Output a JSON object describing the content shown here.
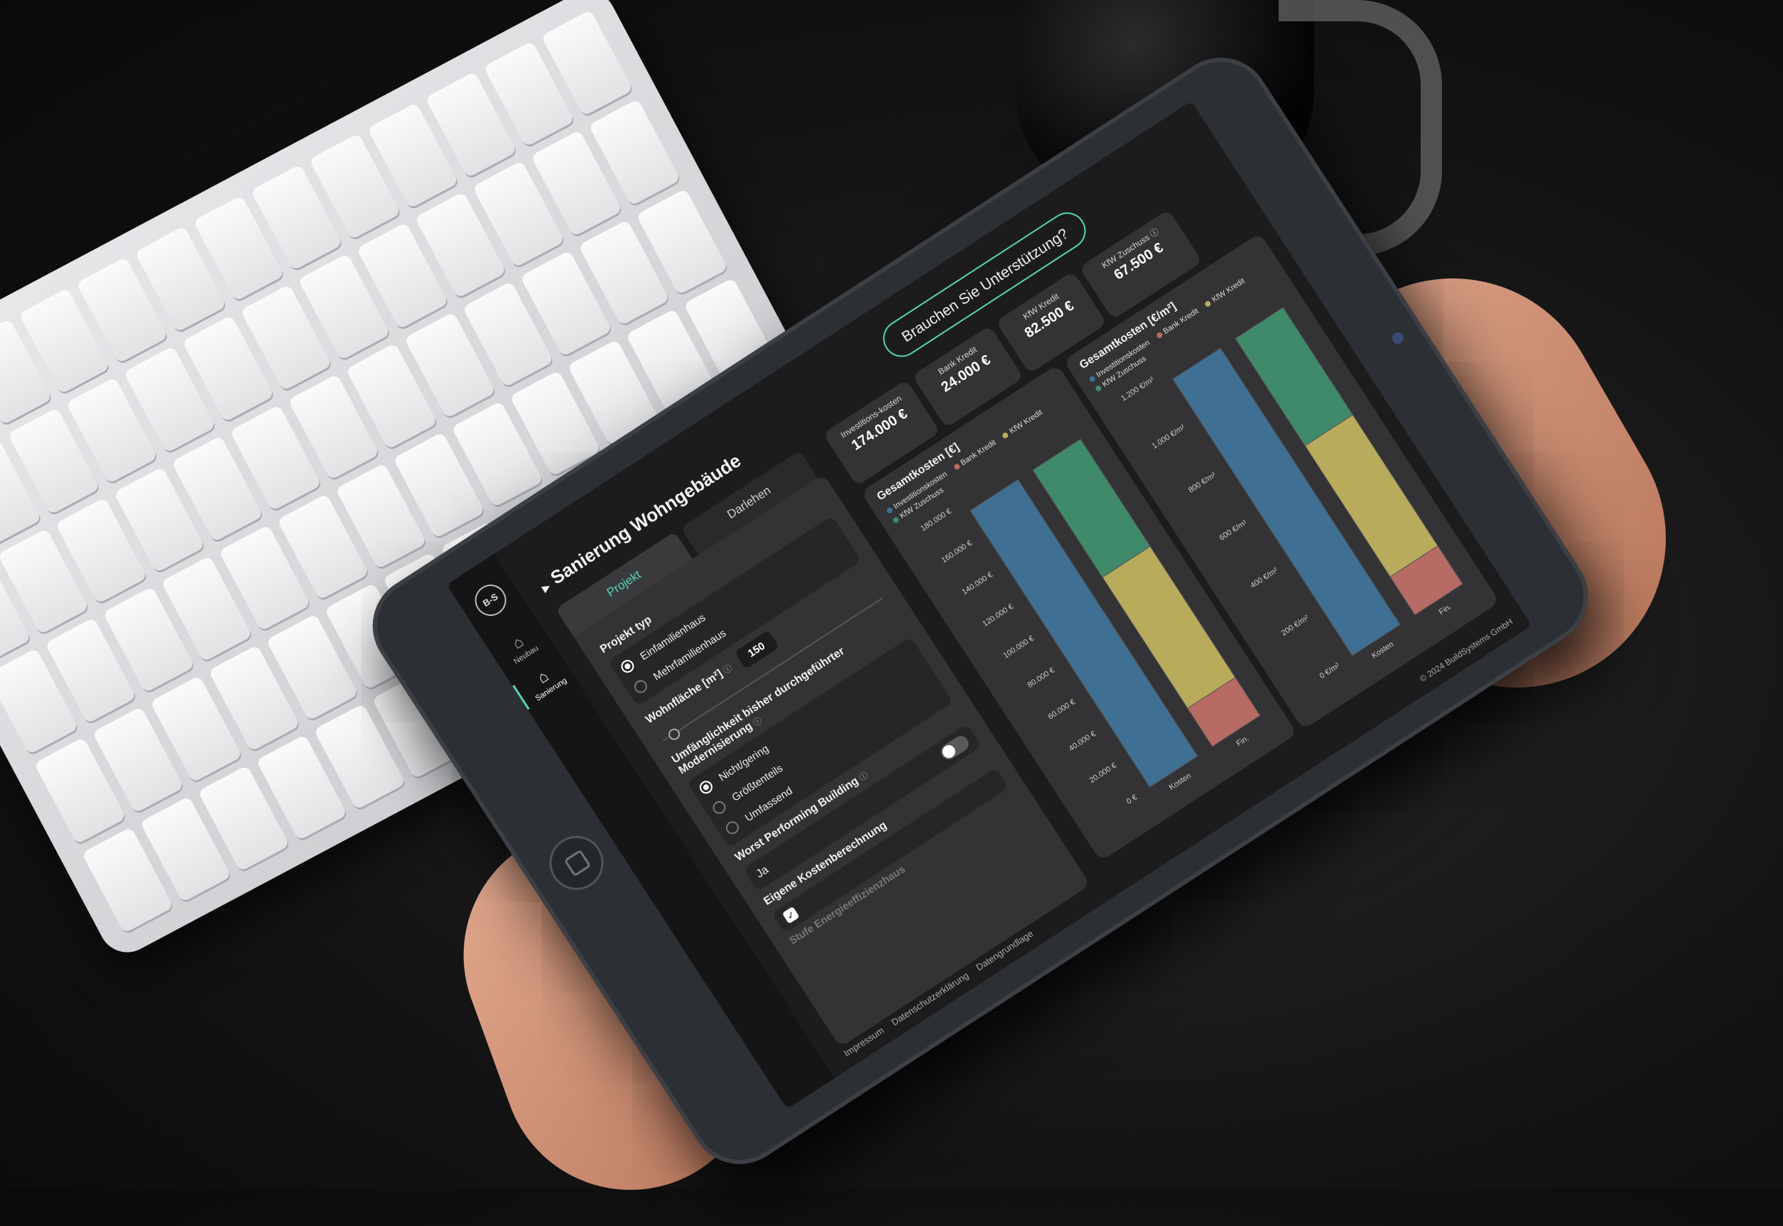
{
  "app": {
    "logo": "B-S",
    "title": "Sanierung Wohngebäude",
    "support_button": "Brauchen Sie Unterstützung?"
  },
  "sidebar": {
    "items": [
      {
        "label": "Neubau",
        "icon": "house-plus-icon"
      },
      {
        "label": "Sanierung",
        "icon": "house-renovate-icon"
      }
    ]
  },
  "tabs": [
    {
      "label": "Projekt",
      "active": true
    },
    {
      "label": "Darlehen",
      "active": false
    }
  ],
  "form": {
    "project_type_label": "Projekt typ",
    "project_type_options": [
      "Einfamilienhaus",
      "Mehrfamilienhaus"
    ],
    "area_label": "Wohnfläche [m²]",
    "area_value": "150",
    "modernization_label": "Umfänglichkeit bisher durchgeführter Modernisierung",
    "modernization_options": [
      "Nicht/gering",
      "Größtenteils",
      "Umfassend"
    ],
    "worst_performing_label": "Worst Performing Building",
    "worst_performing_value": "Ja",
    "own_cost_label": "Eigene Kostenberechnung",
    "energy_level_label": "Stufe Energieeffizienzhaus"
  },
  "stats": [
    {
      "label": "Investitions-kosten",
      "value": "174.000 €"
    },
    {
      "label": "Bank Kredit",
      "value": "24.000 €"
    },
    {
      "label": "KfW Kredit",
      "value": "82.500 €"
    },
    {
      "label": "KfW Zuschuss",
      "value": "67.500 €"
    }
  ],
  "colors": {
    "accent": "#55d7b6",
    "invest": "#3f6f93",
    "bank": "#b86a64",
    "kfw_kredit": "#b8ab5c",
    "kfw_zuschuss": "#3f8a6a"
  },
  "chart_data": [
    {
      "type": "bar",
      "stacked": true,
      "title": "Gesamtkosten [€]",
      "categories": [
        "Kosten",
        "Fin."
      ],
      "series": [
        {
          "name": "Investitionskosten",
          "values": [
            174000,
            0
          ]
        },
        {
          "name": "Bank Kredit",
          "values": [
            0,
            24000
          ]
        },
        {
          "name": "KfW Kredit",
          "values": [
            0,
            82500
          ]
        },
        {
          "name": "KfW Zuschuss",
          "values": [
            0,
            67500
          ]
        }
      ],
      "yticks": [
        "0 €",
        "20.000 €",
        "40.000 €",
        "60.000 €",
        "80.000 €",
        "100.000 €",
        "120.000 €",
        "140.000 €",
        "160.000 €",
        "180.000 €"
      ],
      "ylim": [
        0,
        180000
      ],
      "legend_position": "top-left"
    },
    {
      "type": "bar",
      "stacked": true,
      "title": "Gesamtkosten [€/m²]",
      "categories": [
        "Kosten",
        "Fin."
      ],
      "series": [
        {
          "name": "Investitionskosten",
          "values": [
            1160,
            0
          ]
        },
        {
          "name": "Bank Kredit",
          "values": [
            0,
            160
          ]
        },
        {
          "name": "KfW Kredit",
          "values": [
            0,
            550
          ]
        },
        {
          "name": "KfW Zuschuss",
          "values": [
            0,
            450
          ]
        }
      ],
      "yticks": [
        "0 €/m²",
        "200 €/m²",
        "400 €/m²",
        "600 €/m²",
        "800 €/m²",
        "1.000 €/m²",
        "1.200 €/m²"
      ],
      "ylim": [
        0,
        1200
      ],
      "legend_position": "top-left"
    }
  ],
  "footer": {
    "links": [
      "Impressum",
      "Datenschutzerklärung",
      "Datengrundlage"
    ],
    "copyright": "© 2024 BuildSystems GmbH"
  }
}
